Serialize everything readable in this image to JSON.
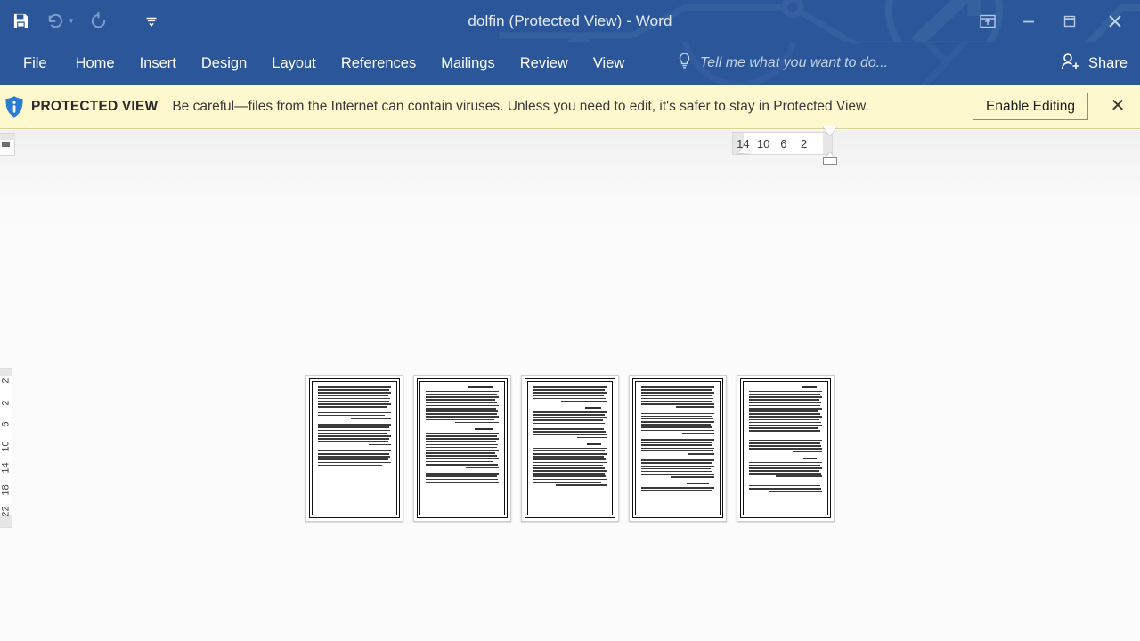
{
  "window": {
    "title": "dolfin (Protected View) - Word",
    "accent_color": "#2b579a",
    "controls": {
      "ribbon_display_options": "ribbon-display-options",
      "minimize": "minimize",
      "restore": "restore",
      "close": "close"
    }
  },
  "quick_access": {
    "save": "Save",
    "undo": "Undo",
    "undo_dropdown": "Undo options",
    "redo": "Redo",
    "customize": "Customize Quick Access Toolbar"
  },
  "ribbon": {
    "tabs": [
      {
        "label": "File"
      },
      {
        "label": "Home"
      },
      {
        "label": "Insert"
      },
      {
        "label": "Design"
      },
      {
        "label": "Layout"
      },
      {
        "label": "References"
      },
      {
        "label": "Mailings"
      },
      {
        "label": "Review"
      },
      {
        "label": "View"
      }
    ],
    "tell_me": "Tell me what you want to do...",
    "share": "Share"
  },
  "protected_view": {
    "label": "PROTECTED VIEW",
    "message": "Be careful—files from the Internet can contain viruses. Unless you need to edit, it's safer to stay in Protected View.",
    "enable_button": "Enable Editing",
    "close_button": "✕",
    "background_color": "#fdf8cd"
  },
  "rulers": {
    "horizontal_numbers": [
      "14",
      "10",
      "6",
      "2"
    ],
    "vertical_numbers": [
      "2",
      "2",
      "6",
      "10",
      "14",
      "18",
      "22"
    ]
  },
  "document": {
    "page_count": 5,
    "pages": [
      {
        "name": "page-1"
      },
      {
        "name": "page-2"
      },
      {
        "name": "page-3"
      },
      {
        "name": "page-4"
      },
      {
        "name": "page-5"
      }
    ]
  }
}
